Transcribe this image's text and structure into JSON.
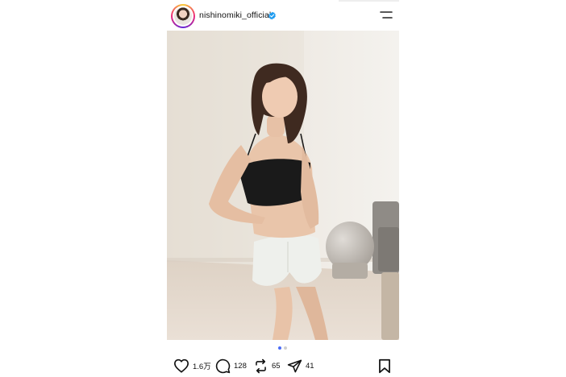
{
  "post": {
    "username": "nishinomiki_official",
    "verified_icon": "verified-badge-icon",
    "menu_icon": "menu-icon",
    "image_description_icon": "post-photo"
  },
  "carousel": {
    "total": 2,
    "active": 1,
    "active_color": "#4a6cf7",
    "inactive_color": "#cfcfcf"
  },
  "actions": {
    "likes": "1.6万",
    "comments": "128",
    "reposts": "65",
    "shares": "41"
  },
  "colors": {
    "verified": "#1d9bf0",
    "text": "#111111"
  }
}
